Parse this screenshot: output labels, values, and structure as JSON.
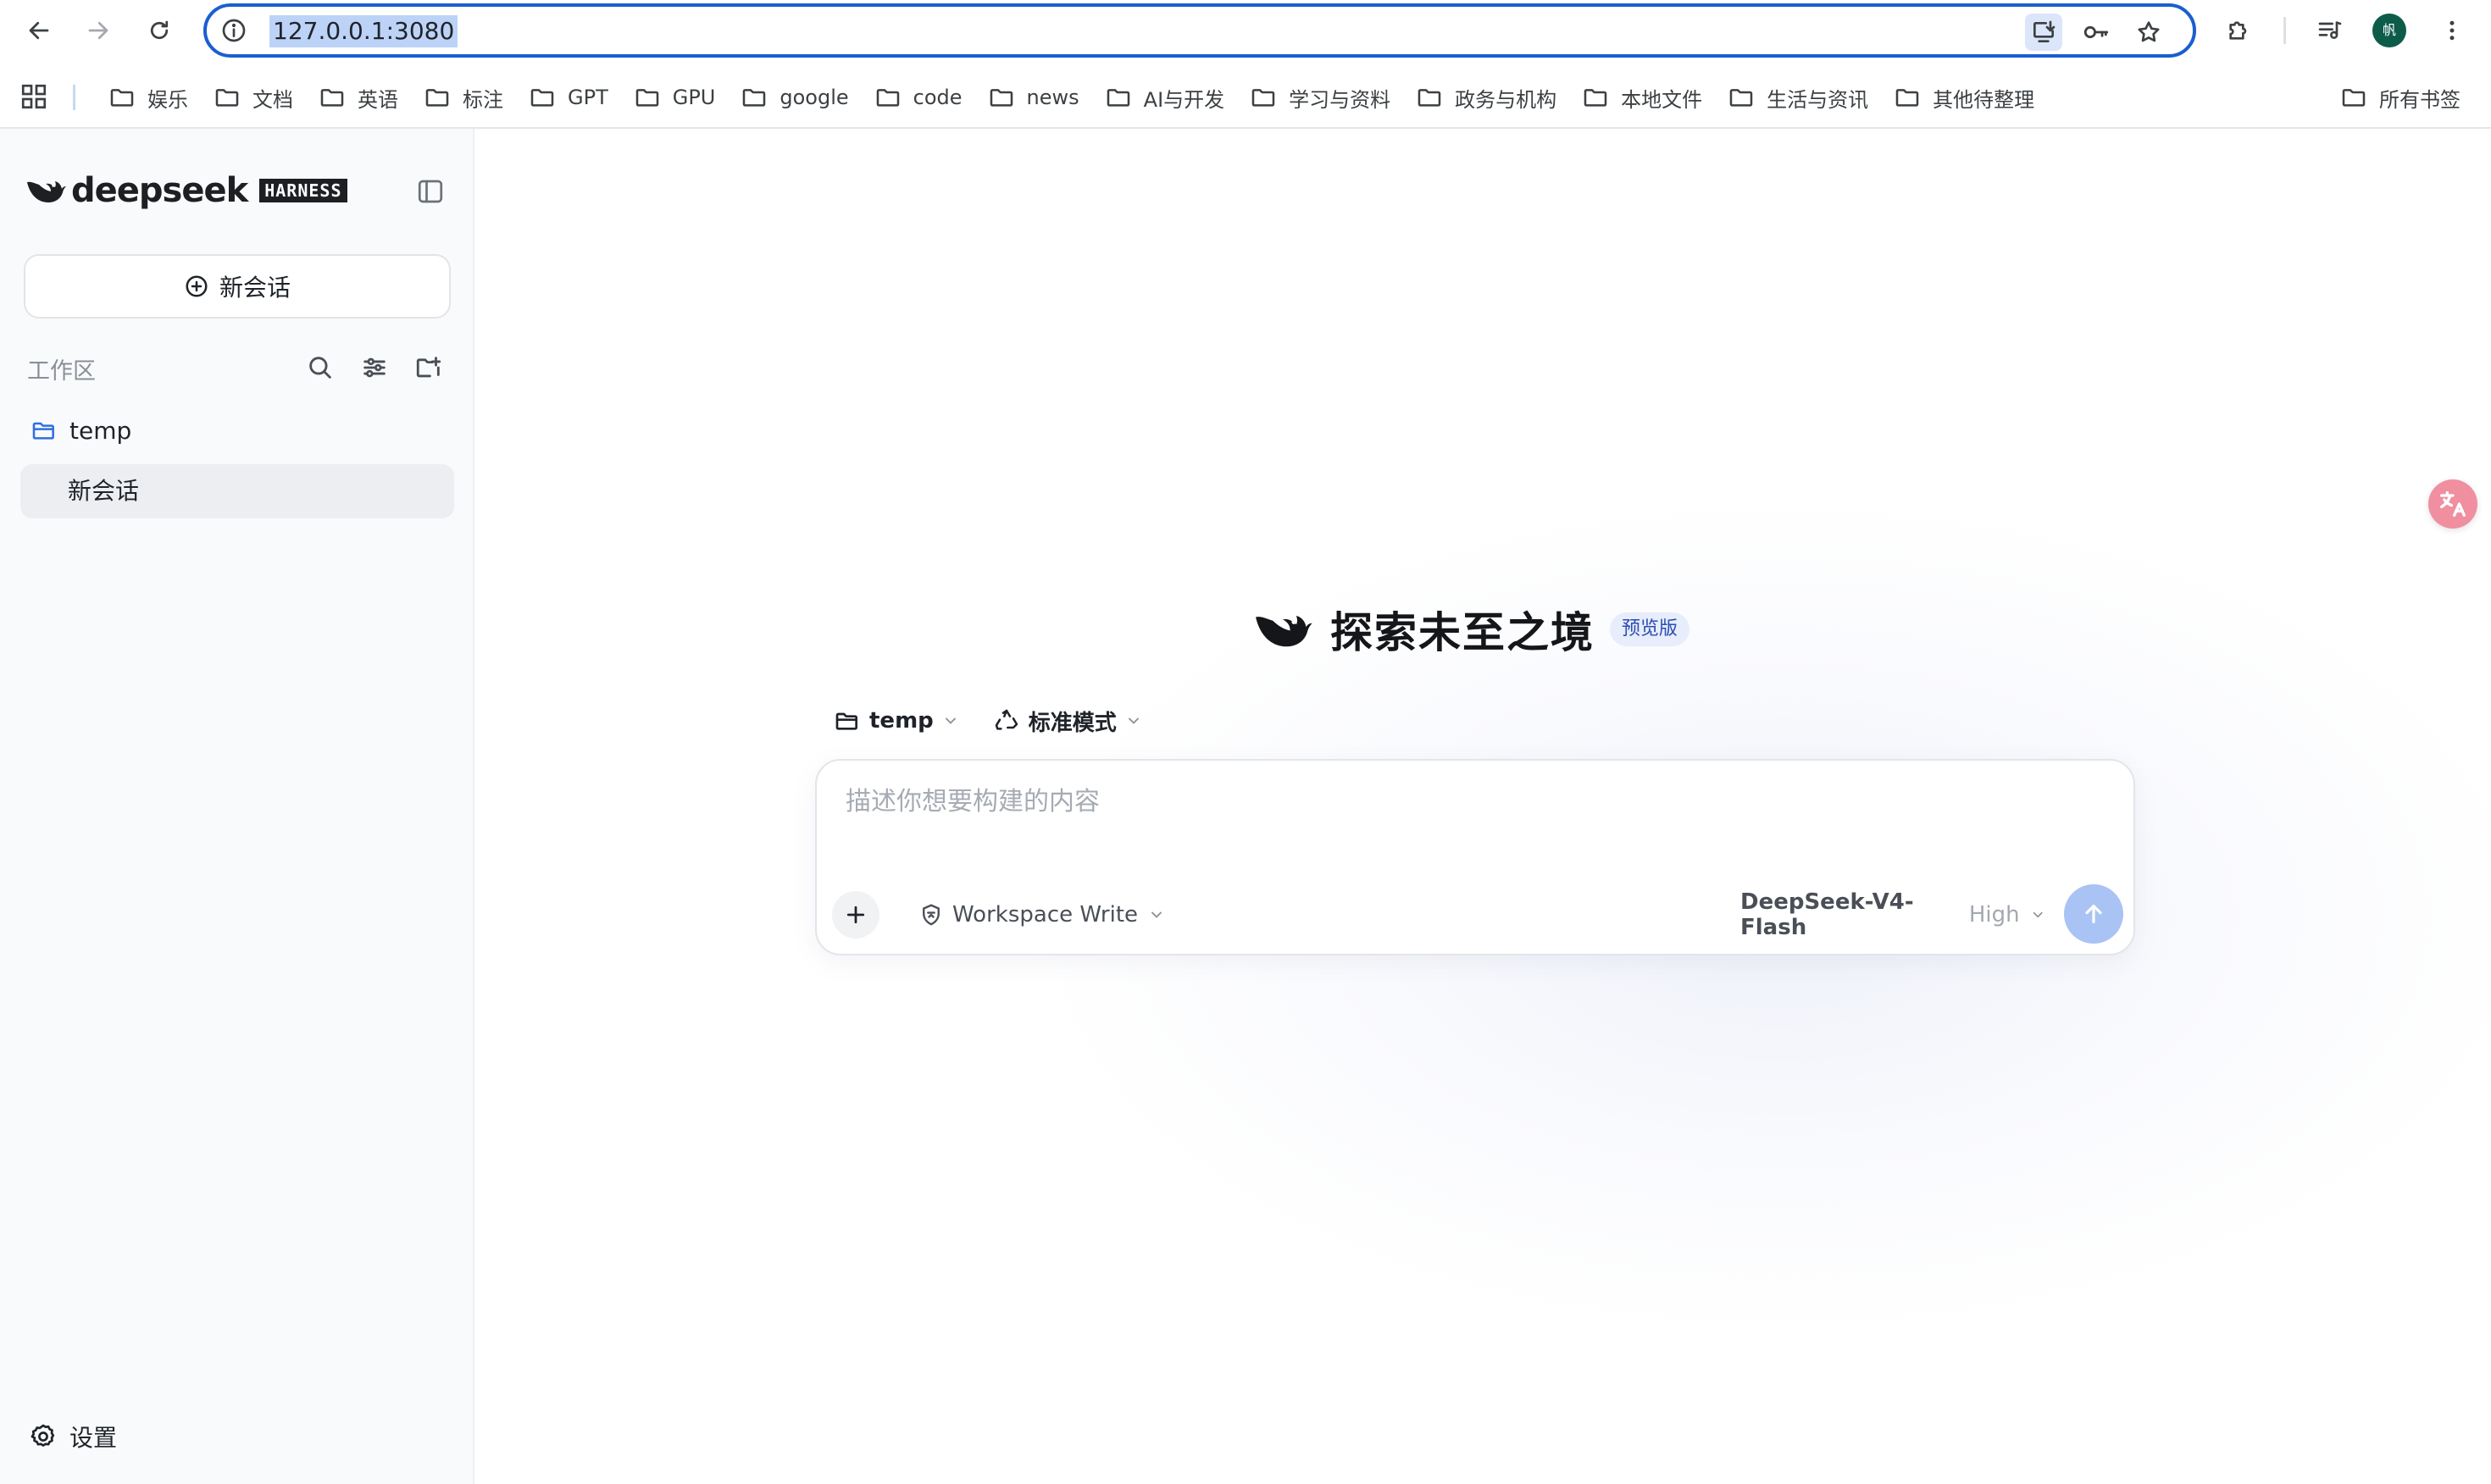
{
  "browser": {
    "url": "127.0.0.1:3080",
    "avatar_text": "帆",
    "bookmarks": [
      {
        "label": "娱乐"
      },
      {
        "label": "文档"
      },
      {
        "label": "英语"
      },
      {
        "label": "标注"
      },
      {
        "label": "GPT"
      },
      {
        "label": "GPU"
      },
      {
        "label": "google"
      },
      {
        "label": "code"
      },
      {
        "label": "news"
      },
      {
        "label": "AI与开发"
      },
      {
        "label": "学习与资料"
      },
      {
        "label": "政务与机构"
      },
      {
        "label": "本地文件"
      },
      {
        "label": "生活与资讯"
      },
      {
        "label": "其他待整理"
      }
    ],
    "all_bookmarks_label": "所有书签"
  },
  "sidebar": {
    "brand": "deepseek",
    "brand_badge": "HARNESS",
    "new_chat_label": "新会话",
    "workspace_label": "工作区",
    "folder_name": "temp",
    "session_title": "新会话",
    "settings_label": "设置"
  },
  "main": {
    "hero_title": "探索未至之境",
    "hero_badge": "预览版",
    "workspace_chip": "temp",
    "mode_chip": "标准模式",
    "composer": {
      "placeholder": "描述你想要构建的内容",
      "value": "",
      "permission_label": "Workspace Write",
      "model_name": "DeepSeek-V4-Flash",
      "model_level": "High"
    }
  },
  "colors": {
    "accent_border": "#1a5fd0",
    "url_selection": "#bcd3f7",
    "send_button": "#a9c3f5",
    "badge_bg": "#e7edfb",
    "badge_text": "#2b4cb3",
    "avatar_bg": "#0d5c4a",
    "translate_fab": "#ef8fa0"
  },
  "icons": {
    "back": "arrow-left-icon",
    "forward": "arrow-right-icon",
    "reload": "reload-icon",
    "site_info": "info-circle-icon",
    "install": "install-app-icon",
    "passwords": "key-icon",
    "bookmark": "star-icon",
    "extensions": "puzzle-icon",
    "media": "media-queue-icon",
    "menu": "kebab-menu-icon",
    "folder": "folder-icon",
    "search": "search-icon",
    "filter": "sliders-icon",
    "new_folder": "folder-plus-icon",
    "settings": "gear-icon",
    "send": "arrow-up-icon",
    "translate": "translate-icon"
  }
}
